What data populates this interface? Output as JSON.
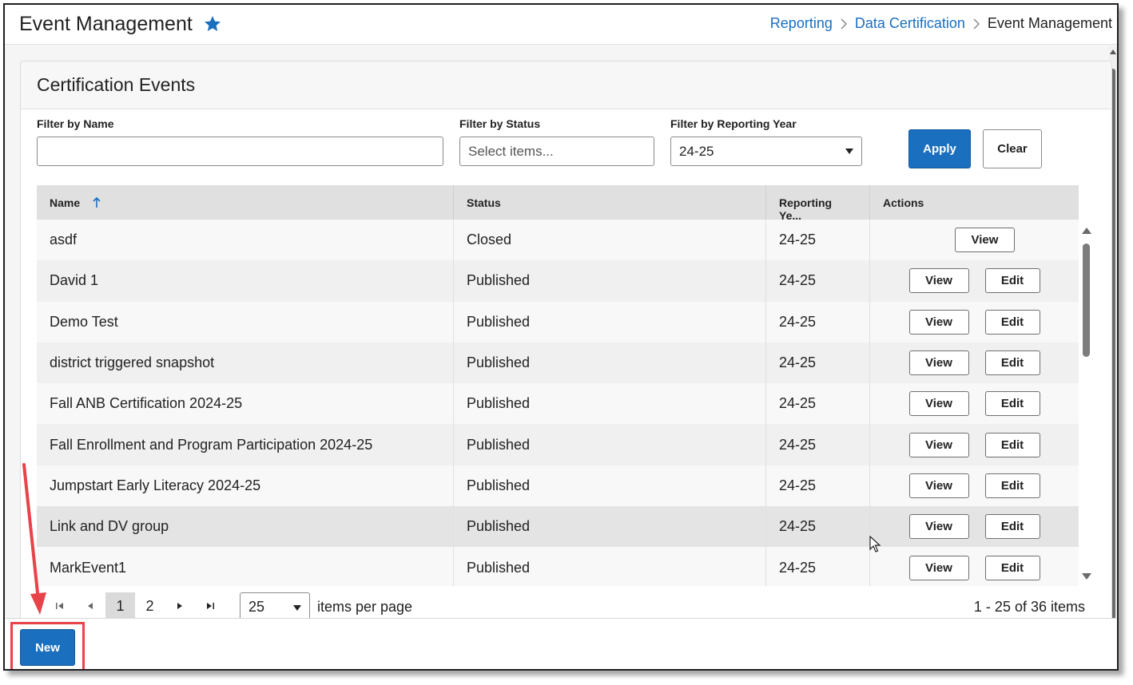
{
  "header": {
    "title": "Event Management",
    "breadcrumb": [
      "Reporting",
      "Data Certification",
      "Event Management"
    ]
  },
  "card": {
    "title": "Certification Events"
  },
  "filters": {
    "name_label": "Filter by Name",
    "name_value": "",
    "status_label": "Filter by Status",
    "status_placeholder": "Select items...",
    "year_label": "Filter by Reporting Year",
    "year_value": "24-25",
    "apply_label": "Apply",
    "clear_label": "Clear"
  },
  "table": {
    "columns": [
      "Name",
      "Status",
      "Reporting Ye...",
      "Actions"
    ],
    "rows": [
      {
        "name": "asdf",
        "status": "Closed",
        "year": "24-25",
        "view": "View",
        "edit": ""
      },
      {
        "name": "David 1",
        "status": "Published",
        "year": "24-25",
        "view": "View",
        "edit": "Edit"
      },
      {
        "name": "Demo Test",
        "status": "Published",
        "year": "24-25",
        "view": "View",
        "edit": "Edit"
      },
      {
        "name": "district triggered snapshot",
        "status": "Published",
        "year": "24-25",
        "view": "View",
        "edit": "Edit"
      },
      {
        "name": "Fall ANB Certification 2024-25",
        "status": "Published",
        "year": "24-25",
        "view": "View",
        "edit": "Edit"
      },
      {
        "name": "Fall Enrollment and Program Participation 2024-25",
        "status": "Published",
        "year": "24-25",
        "view": "View",
        "edit": "Edit"
      },
      {
        "name": "Jumpstart Early Literacy 2024-25",
        "status": "Published",
        "year": "24-25",
        "view": "View",
        "edit": "Edit"
      },
      {
        "name": "Link and DV group",
        "status": "Published",
        "year": "24-25",
        "view": "View",
        "edit": "Edit"
      },
      {
        "name": "MarkEvent1",
        "status": "Published",
        "year": "24-25",
        "view": "View",
        "edit": "Edit"
      }
    ]
  },
  "pager": {
    "pages": [
      "1",
      "2"
    ],
    "page_size": "25",
    "page_size_label": "items per page",
    "summary": "1 - 25 of 36 items"
  },
  "footer": {
    "new_label": "New"
  },
  "colors": {
    "primary": "#1a6fbf",
    "highlight": "#e8424a"
  }
}
